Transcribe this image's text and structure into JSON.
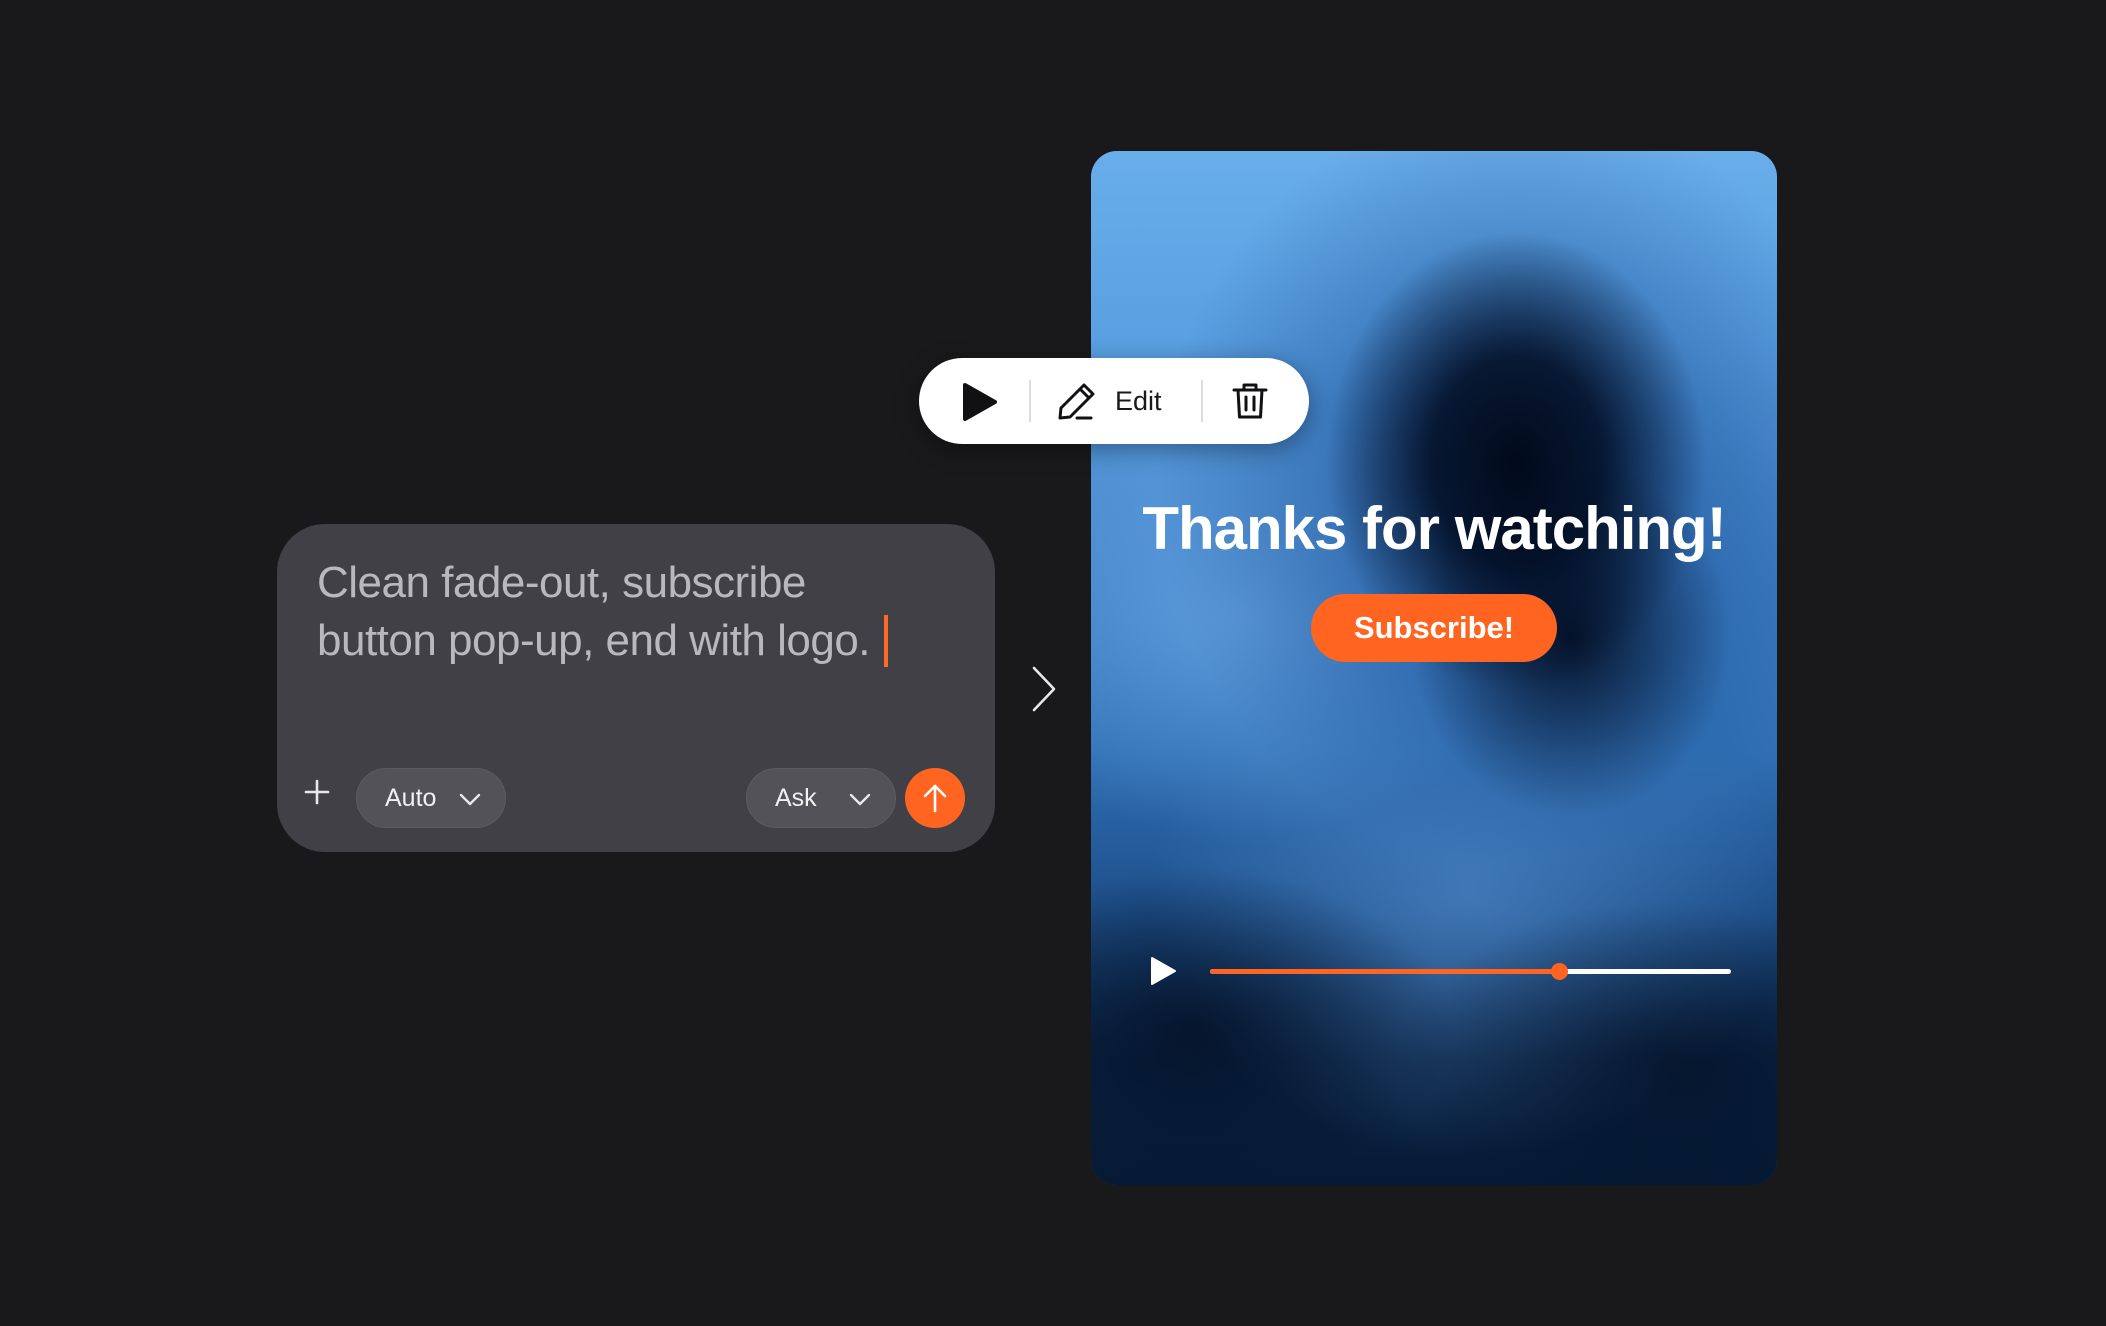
{
  "prompt": {
    "text_line1": "Clean fade-out, subscribe",
    "text_line2": "button pop-up, end with logo.",
    "mode_label": "Auto",
    "action_label": "Ask",
    "add_icon": "plus-icon",
    "send_icon": "arrow-up-icon"
  },
  "toolbar": {
    "play_icon": "play-icon",
    "edit_icon": "pencil-icon",
    "edit_label": "Edit",
    "delete_icon": "trash-icon"
  },
  "video": {
    "title": "Thanks for watching!",
    "cta_label": "Subscribe!",
    "progress_fraction": 0.67
  },
  "colors": {
    "background": "#19191b",
    "card": "#414046",
    "accent": "#ff6420",
    "toolbar_bg": "#ffffff"
  }
}
